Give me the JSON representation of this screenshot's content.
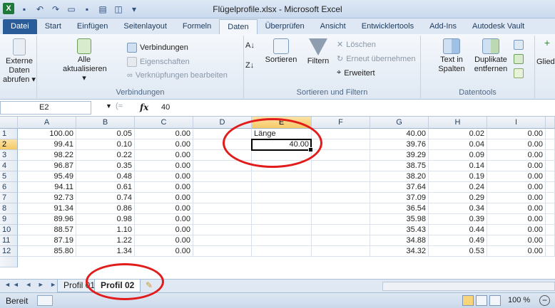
{
  "window": {
    "title": "Flügelprofile.xlsx - Microsoft Excel",
    "app_logo": "X"
  },
  "qat_icons": [
    "save-icon",
    "undo-icon",
    "redo-icon",
    "open-icon",
    "save-as-icon",
    "print-icon",
    "preview-icon",
    "customize-icon"
  ],
  "ribbon_tabs": [
    "Datei",
    "Start",
    "Einfügen",
    "Seitenlayout",
    "Formeln",
    "Daten",
    "Überprüfen",
    "Ansicht",
    "Entwicklertools",
    "Add-Ins",
    "Autodesk Vault"
  ],
  "active_tab_index": 5,
  "ribbon": {
    "external_data": "Externe Daten abrufen ▾",
    "refresh_all": "Alle aktualisieren ▾",
    "connections": "Verbindungen",
    "properties": "Eigenschaften",
    "edit_links": "Verknüpfungen bearbeiten",
    "group_connections": "Verbindungen",
    "sort": "Sortieren",
    "filter": "Filtern",
    "clear": "Löschen",
    "reapply": "Erneut übernehmen",
    "advanced": "Erweitert",
    "group_sort_filter": "Sortieren und Filtern",
    "text_to_columns": "Text in Spalten",
    "remove_duplicates": "Duplikate entfernen",
    "group_data_tools": "Datentools",
    "outline": "Gliede"
  },
  "formula_bar": {
    "name_box": "E2",
    "fx": "fx",
    "value": "40"
  },
  "columns": [
    "A",
    "B",
    "C",
    "D",
    "E",
    "F",
    "G",
    "H",
    "I"
  ],
  "selected_column": "E",
  "selected_row": 2,
  "rows": [
    {
      "n": "1",
      "A": "100.00",
      "B": "0.05",
      "C": "0.00",
      "E": "Länge",
      "G": "40.00",
      "H": "0.02",
      "I": "0.00"
    },
    {
      "n": "2",
      "A": "99.41",
      "B": "0.10",
      "C": "0.00",
      "E": "40.00",
      "G": "39.76",
      "H": "0.04",
      "I": "0.00"
    },
    {
      "n": "3",
      "A": "98.22",
      "B": "0.22",
      "C": "0.00",
      "E": "",
      "G": "39.29",
      "H": "0.09",
      "I": "0.00"
    },
    {
      "n": "4",
      "A": "96.87",
      "B": "0.35",
      "C": "0.00",
      "E": "",
      "G": "38.75",
      "H": "0.14",
      "I": "0.00"
    },
    {
      "n": "5",
      "A": "95.49",
      "B": "0.48",
      "C": "0.00",
      "E": "",
      "G": "38.20",
      "H": "0.19",
      "I": "0.00"
    },
    {
      "n": "6",
      "A": "94.11",
      "B": "0.61",
      "C": "0.00",
      "E": "",
      "G": "37.64",
      "H": "0.24",
      "I": "0.00"
    },
    {
      "n": "7",
      "A": "92.73",
      "B": "0.74",
      "C": "0.00",
      "E": "",
      "G": "37.09",
      "H": "0.29",
      "I": "0.00"
    },
    {
      "n": "8",
      "A": "91.34",
      "B": "0.86",
      "C": "0.00",
      "E": "",
      "G": "36.54",
      "H": "0.34",
      "I": "0.00"
    },
    {
      "n": "9",
      "A": "89.96",
      "B": "0.98",
      "C": "0.00",
      "E": "",
      "G": "35.98",
      "H": "0.39",
      "I": "0.00"
    },
    {
      "n": "10",
      "A": "88.57",
      "B": "1.10",
      "C": "0.00",
      "E": "",
      "G": "35.43",
      "H": "0.44",
      "I": "0.00"
    },
    {
      "n": "11",
      "A": "87.19",
      "B": "1.22",
      "C": "0.00",
      "E": "",
      "G": "34.88",
      "H": "0.49",
      "I": "0.00"
    },
    {
      "n": "12",
      "A": "85.80",
      "B": "1.34",
      "C": "0.00",
      "E": "",
      "G": "34.32",
      "H": "0.53",
      "I": "0.00"
    }
  ],
  "sheet_tabs": [
    "Profil 01",
    "Profil 02"
  ],
  "active_sheet_index": 1,
  "status": {
    "ready": "Bereit",
    "zoom": "100 %",
    "zoom_out": "−"
  },
  "colors": {
    "accent_file_tab": "#2a5c9a",
    "selection_header": "#f6c965",
    "annotation_ring": "#e21b1b"
  }
}
